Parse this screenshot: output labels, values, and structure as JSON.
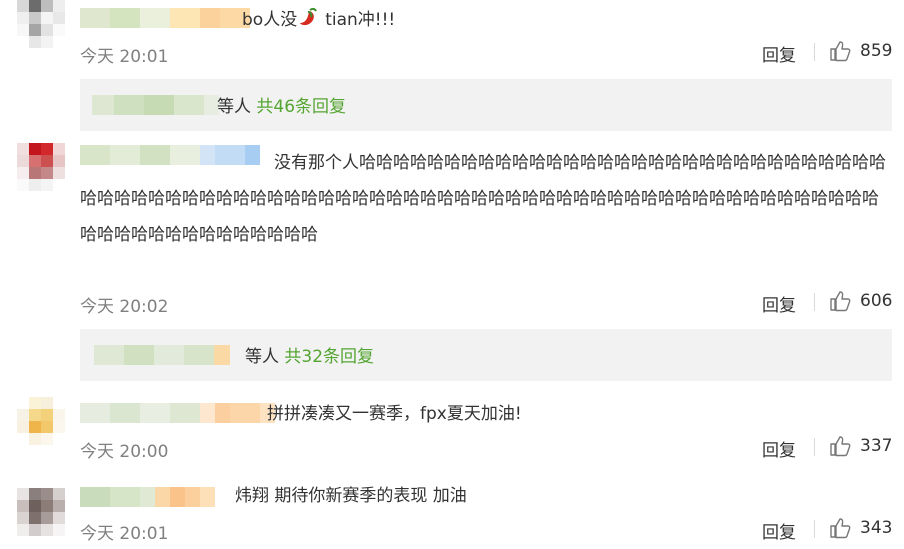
{
  "comments": [
    {
      "text_a": "bo人没",
      "text_b": "tian冲!!!",
      "time": "今天 20:01",
      "reply_label": "回复",
      "likes": "859",
      "sub": {
        "suffix": "等人",
        "count_text": "共46条回复"
      },
      "icons": [
        "chili-pepper-icon",
        "like-icon"
      ]
    },
    {
      "text": "没有那个人哈哈哈哈哈哈哈哈哈哈哈哈哈哈哈哈哈哈哈哈哈哈哈哈哈哈哈哈哈哈哈哈哈哈哈哈哈哈哈哈哈哈哈哈哈哈哈哈哈哈哈哈哈哈哈哈哈哈哈哈哈哈哈哈哈哈哈哈哈哈哈哈哈哈哈哈哈哈哈哈哈哈哈哈哈哈哈哈哈哈哈哈",
      "time": "今天 20:02",
      "reply_label": "回复",
      "likes": "606",
      "sub": {
        "suffix": "等人",
        "count_text": "共32条回复"
      }
    },
    {
      "text": "拼拼凑凑又一赛季，fpx夏天加油!",
      "time": "今天 20:00",
      "reply_label": "回复",
      "likes": "337"
    },
    {
      "text": "炜翔 期待你新赛季的表现 加油",
      "time": "今天 20:01",
      "reply_label": "回复",
      "likes": "343"
    }
  ],
  "colors": {
    "link_green": "#55a532",
    "time_gray": "#808080",
    "sub_bg": "#f2f2f2"
  }
}
